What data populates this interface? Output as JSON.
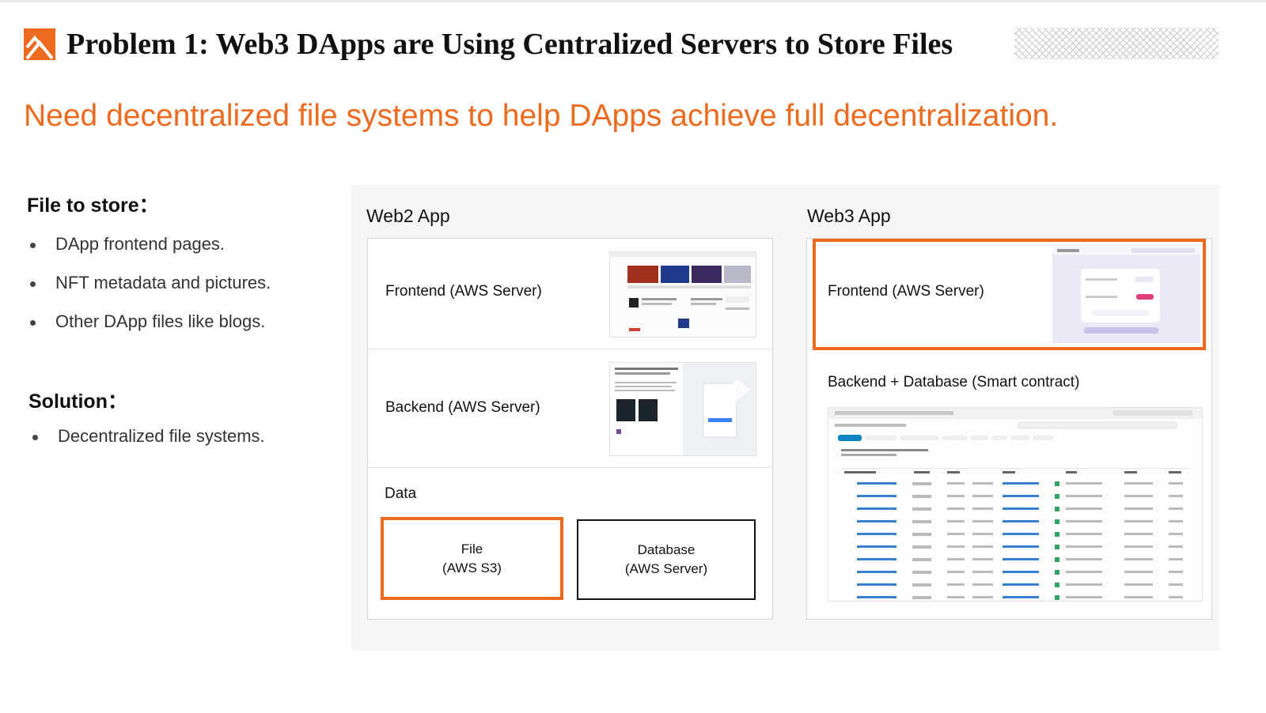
{
  "header": {
    "title": "Problem 1: Web3 DApps are Using Centralized Servers to Store Files",
    "subtitle": "Need decentralized file systems to help DApps achieve full decentralization.",
    "logo_icon": "orange-chevron-logo",
    "accent_color": "#ee6a1e"
  },
  "left": {
    "file_heading": "File to store：",
    "file_items": [
      "DApp frontend pages.",
      "NFT metadata and pictures.",
      "Other DApp files like blogs."
    ],
    "solution_heading": "Solution：",
    "solution_items": [
      "Decentralized file systems."
    ]
  },
  "web2": {
    "title": "Web2 App",
    "frontend_label": "Frontend (AWS Server)",
    "backend_label": "Backend (AWS Server)",
    "data_label": "Data",
    "file_box": "File\n(AWS S3)",
    "database_box": "Database\n(AWS Server)"
  },
  "web3": {
    "title": "Web3 App",
    "frontend_label": "Frontend (AWS Server)",
    "backend_label": "Backend + Database (Smart contract)"
  }
}
